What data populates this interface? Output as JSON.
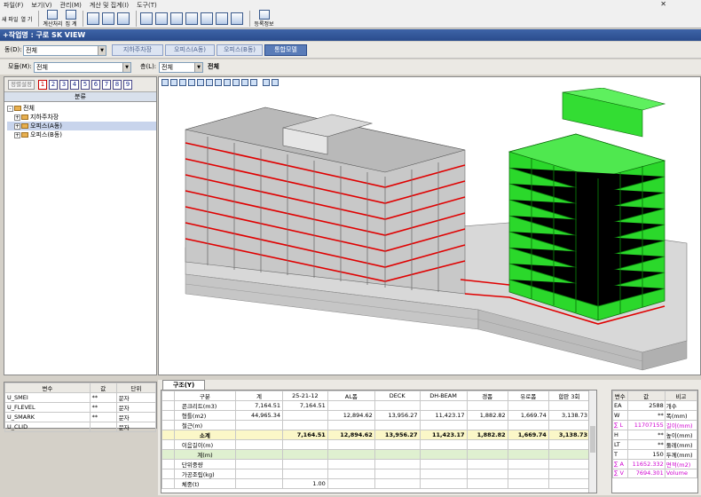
{
  "menu": [
    "파일(F)",
    "보기(V)",
    "관리(M)",
    "계산 및 집계(I)",
    "도구(T)"
  ],
  "toolbar": {
    "new": "새 파일",
    "open": "열 기",
    "calc": "계산처리",
    "total": "집 계",
    "register": "등록정보"
  },
  "title_bar": "+작업명 : 구로 SK VIEW",
  "building": {
    "label": "동(D):",
    "value": "전체"
  },
  "module": {
    "label": "모듈(M):",
    "value": "전체"
  },
  "floor": {
    "label": "층(L):",
    "value": "전체",
    "extra": "전체"
  },
  "view_tabs": [
    {
      "label": "지하주차장",
      "active": false
    },
    {
      "label": "오피스(A동)",
      "active": false
    },
    {
      "label": "오피스(B동)",
      "active": false
    },
    {
      "label": "통합모델",
      "active": true
    }
  ],
  "left_panel": {
    "reset_button": "정렬설정",
    "numbers": [
      "1",
      "2",
      "3",
      "4",
      "5",
      "6",
      "7",
      "8",
      "9"
    ],
    "header": "분류",
    "tree": [
      {
        "label": "전체",
        "level": 0,
        "sign": "-"
      },
      {
        "label": "지하주차장",
        "level": 1,
        "sign": "+"
      },
      {
        "label": "오피스(A동)",
        "level": 1,
        "sign": "+",
        "selected": true
      },
      {
        "label": "오피스(B동)",
        "level": 1,
        "sign": "+"
      }
    ]
  },
  "var_table": {
    "headers": [
      "변수",
      "값",
      "단위"
    ],
    "rows": [
      [
        "U_SMEI",
        "**",
        "문자"
      ],
      [
        "U_FLEVEL",
        "**",
        "문자"
      ],
      [
        "U_SMARK",
        "**",
        "문자"
      ],
      [
        "U_CLID",
        "",
        "문자"
      ]
    ]
  },
  "bottom_tab": "구조(Y)",
  "main_grid": {
    "headers": [
      "구분",
      "계",
      "25-21-12",
      "AL폼",
      "DECK",
      "DH-BEAM",
      "갱폼",
      "유로폼",
      "합판 3회"
    ],
    "rows": [
      {
        "label": "콘크리트(m3)",
        "values": [
          "7,164.51",
          "7,164.51",
          "",
          "",
          "",
          "",
          "",
          ""
        ],
        "style": ""
      },
      {
        "label": "형틀(m2)",
        "values": [
          "44,965.34",
          "",
          "12,894.62",
          "13,956.27",
          "11,423.17",
          "1,882.82",
          "1,669.74",
          "3,138.73"
        ],
        "style": ""
      },
      {
        "label": "철근(m)",
        "values": [
          "",
          "",
          "",
          "",
          "",
          "",
          "",
          ""
        ],
        "style": ""
      },
      {
        "label": "소계",
        "values": [
          "",
          "7,164.51",
          "12,894.62",
          "13,956.27",
          "11,423.17",
          "1,882.82",
          "1,669.74",
          "3,138.73"
        ],
        "style": "sub"
      },
      {
        "label": "이음길이(m)",
        "values": [
          "",
          "",
          "",
          "",
          "",
          "",
          "",
          ""
        ],
        "style": ""
      },
      {
        "label": "계(m)",
        "values": [
          "",
          "",
          "",
          "",
          "",
          "",
          "",
          ""
        ],
        "style": "grn"
      },
      {
        "label": "단위중량",
        "values": [
          "",
          "",
          "",
          "",
          "",
          "",
          "",
          ""
        ],
        "style": ""
      },
      {
        "label": "가공조립(kg)",
        "values": [
          "",
          "",
          "",
          "",
          "",
          "",
          "",
          ""
        ],
        "style": ""
      },
      {
        "label": "체중(t)",
        "values": [
          "",
          "1.00",
          "",
          "",
          "",
          "",
          "",
          ""
        ],
        "style": ""
      }
    ]
  },
  "right_table": {
    "headers": [
      "변수",
      "값",
      "비고"
    ],
    "rows": [
      {
        "sym": "EA",
        "val": "2588",
        "note": "개수",
        "pink": false
      },
      {
        "sym": "W",
        "val": "**",
        "note": "폭(mm)",
        "pink": false
      },
      {
        "sym": "∑ L",
        "val": "11707155",
        "note": "길이(mm)",
        "pink": true
      },
      {
        "sym": "H",
        "val": "**",
        "note": "높이(mm)",
        "pink": false
      },
      {
        "sym": "LT",
        "val": "**",
        "note": "둘레(mm)",
        "pink": false
      },
      {
        "sym": "T",
        "val": "150",
        "note": "두께(mm)",
        "pink": false
      },
      {
        "sym": "∑ A",
        "val": "11652.332",
        "note": "면적(m2)",
        "pink": true
      },
      {
        "sym": "∑ V",
        "val": "7694.301",
        "note": "Volume",
        "pink": true
      }
    ]
  },
  "colors": {
    "frame_red": "#e00000",
    "highlight_green": "#22d622",
    "title_blue": "#2a4c8c"
  }
}
